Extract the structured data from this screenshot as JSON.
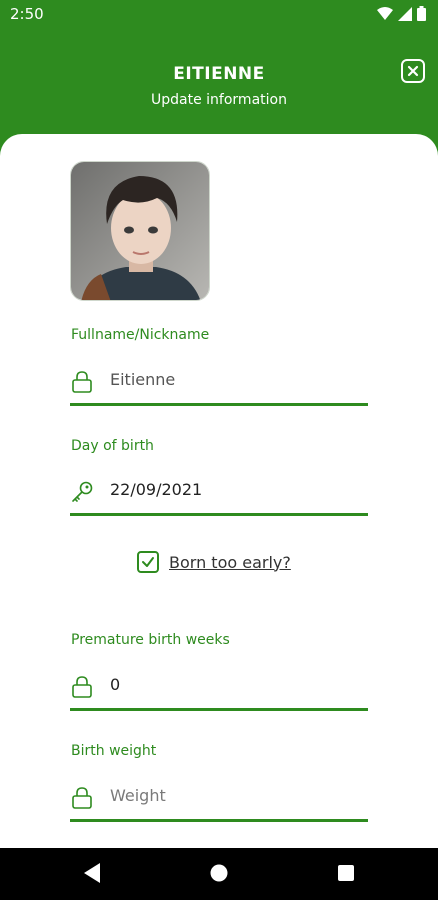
{
  "status_bar": {
    "time": "2:50",
    "icons": [
      "wifi-icon",
      "signal-icon",
      "battery-icon"
    ]
  },
  "header": {
    "title": "EITIENNE",
    "subtitle": "Update information",
    "close_icon": "close-icon"
  },
  "form": {
    "fullname": {
      "label": "Fullname/Nickname",
      "value": "Eitienne",
      "icon": "lock-icon"
    },
    "birthday": {
      "label": "Day of birth",
      "value": "22/09/2021",
      "icon": "key-icon"
    },
    "born_early": {
      "label": "Born too early?",
      "checked": true
    },
    "premature_weeks": {
      "label": "Premature birth weeks",
      "value": "0",
      "icon": "lock-icon"
    },
    "birth_weight": {
      "label": "Birth weight",
      "placeholder": "Weight",
      "icon": "lock-icon"
    }
  },
  "nav": {
    "buttons": [
      "back-icon",
      "home-icon",
      "recents-icon"
    ]
  },
  "colors": {
    "accent": "#2e8b1f",
    "background": "#ffffff",
    "nav_bar": "#000000"
  }
}
